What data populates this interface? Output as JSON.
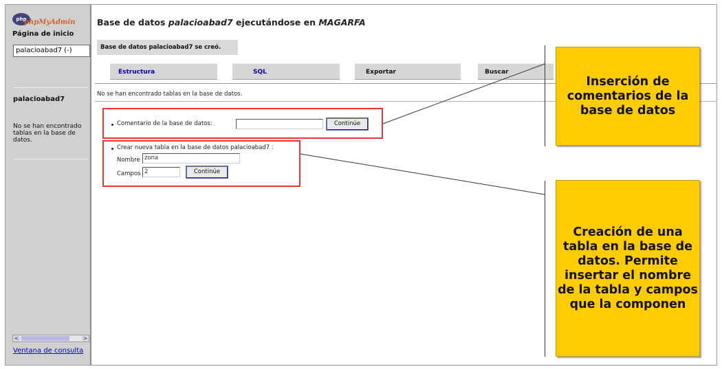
{
  "sidebar": {
    "logo_text": "phpMyAdmin",
    "logo_badge": "php",
    "home_link": "Página de inicio",
    "db_select_value": "palacioabad7 (-)",
    "db_name": "palacioabad7",
    "empty_note": "No se han encontrado tablas en la base de datos.",
    "scroll_left": "<",
    "scroll_right": ">",
    "query_window_link": "Ventana de consulta"
  },
  "main": {
    "title_prefix": "Base de datos ",
    "title_db": "palacioabad7",
    "title_middle": " ejecutándose en ",
    "title_server": "MAGARFA",
    "created_message": "Base de datos palacioabad7 se creó.",
    "tabs": [
      {
        "label": "Estructura"
      },
      {
        "label": "SQL"
      },
      {
        "label": "Exportar"
      },
      {
        "label": "Buscar"
      }
    ],
    "no_tables_message": "No se han encontrado tablas en la base de datos.",
    "comment_form": {
      "label": "Comentario de la base de datos:",
      "value": "",
      "button": "Continúe"
    },
    "create_table_form": {
      "heading": "Crear nueva tabla en la base de datos palacioabad7 :",
      "name_label": "Nombre :",
      "name_value": "zona",
      "fields_label": "Campos :",
      "fields_value": "2",
      "button": "Continúe"
    }
  },
  "callouts": {
    "comment_callout": "Inserción de comentarios de la base de datos",
    "create_table_callout": "Creación de una tabla en la base de datos. Permite insertar el nombre de la tabla y campos que la componen"
  },
  "colors": {
    "sidebar_bg": "#d0d0d0",
    "highlight_border": "#ee3333",
    "callout_bg": "#ffcc00",
    "link": "#0000cc"
  }
}
